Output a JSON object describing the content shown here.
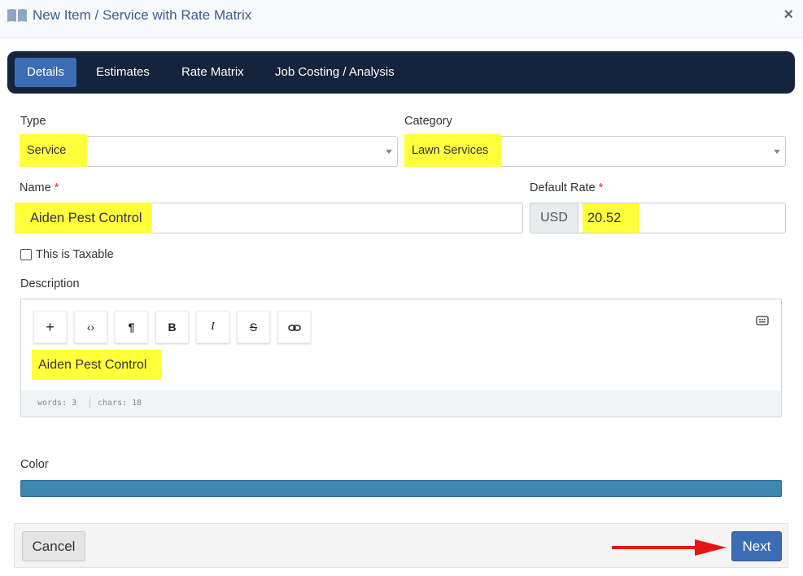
{
  "dialog": {
    "title": "New Item / Service with Rate Matrix",
    "close_label": "×",
    "header_icon": "book-icon"
  },
  "tabs": [
    {
      "label": "Details",
      "active": true
    },
    {
      "label": "Estimates",
      "active": false
    },
    {
      "label": "Rate Matrix",
      "active": false
    },
    {
      "label": "Job Costing / Analysis",
      "active": false
    }
  ],
  "form": {
    "type": {
      "label": "Type",
      "value": "Service"
    },
    "category": {
      "label": "Category",
      "value": "Lawn Services"
    },
    "name": {
      "label": "Name",
      "required_mark": "*",
      "value": "Aiden Pest Control"
    },
    "default_rate": {
      "label": "Default Rate",
      "required_mark": "*",
      "currency": "USD",
      "value": "20.52"
    },
    "taxable": {
      "label": "This is Taxable",
      "checked": false
    },
    "description": {
      "label": "Description",
      "content": "Aiden Pest Control",
      "toolbar": [
        {
          "name": "plus-icon",
          "glyph": "+"
        },
        {
          "name": "code-icon",
          "glyph": "‹›"
        },
        {
          "name": "paragraph-icon",
          "glyph": "¶"
        },
        {
          "name": "bold-icon",
          "glyph": "B"
        },
        {
          "name": "italic-icon",
          "glyph": "I"
        },
        {
          "name": "strikethrough-icon",
          "glyph": "S"
        },
        {
          "name": "link-icon",
          "glyph": "link"
        }
      ],
      "words": "words: 3",
      "chars": "chars: 18"
    },
    "color": {
      "label": "Color",
      "value": "#3d87b0"
    }
  },
  "footer": {
    "cancel_label": "Cancel",
    "next_label": "Next"
  },
  "colors": {
    "highlight": "#ffff3b",
    "tabbar": "#15243d",
    "accent": "#3c6cb4",
    "annotation_arrow": "#e8140f"
  }
}
